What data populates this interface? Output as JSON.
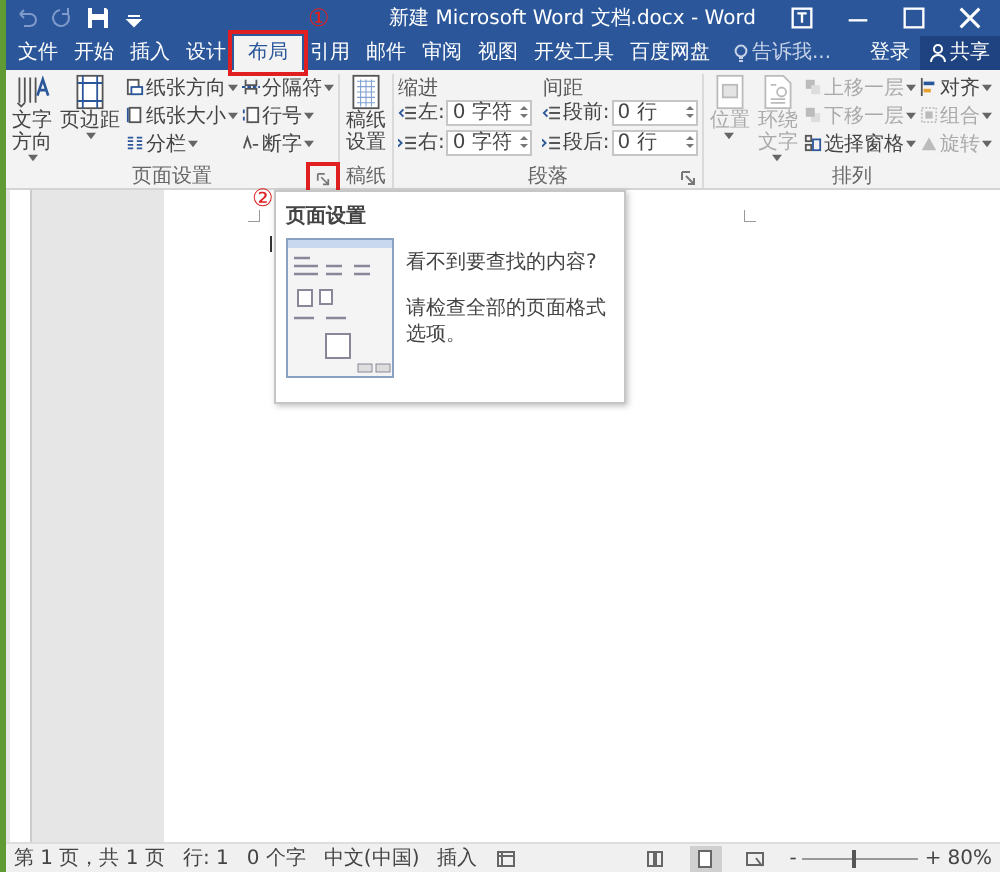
{
  "window": {
    "title": "新建 Microsoft Word 文档.docx - Word"
  },
  "quick_access": [
    {
      "kind": "undo",
      "disabled": true
    },
    {
      "kind": "redo",
      "disabled": true
    },
    {
      "kind": "save",
      "disabled": false
    },
    {
      "kind": "customize",
      "disabled": false
    }
  ],
  "window_controls": [
    {
      "kind": "ribbon-options"
    },
    {
      "kind": "minimize"
    },
    {
      "kind": "maximize"
    },
    {
      "kind": "close"
    }
  ],
  "tabs": [
    {
      "label": "文件",
      "selected": false
    },
    {
      "label": "开始",
      "selected": false
    },
    {
      "label": "插入",
      "selected": false
    },
    {
      "label": "设计",
      "selected": false
    },
    {
      "label": "布局",
      "selected": true,
      "callout": "①"
    },
    {
      "label": "引用",
      "selected": false
    },
    {
      "label": "邮件",
      "selected": false
    },
    {
      "label": "审阅",
      "selected": false
    },
    {
      "label": "视图",
      "selected": false
    },
    {
      "label": "开发工具",
      "selected": false
    },
    {
      "label": "百度网盘",
      "selected": false
    }
  ],
  "tell_me": {
    "placeholder": "告诉我..."
  },
  "account": {
    "sign_in": "登录",
    "share": "共享"
  },
  "page_setup": {
    "label": "页面设置",
    "callout": "②",
    "big_buttons": [
      {
        "label": "文字方向"
      },
      {
        "label": "页边距"
      }
    ],
    "small_buttons": [
      {
        "label": "纸张方向"
      },
      {
        "label": "纸张大小"
      },
      {
        "label": "分栏"
      },
      {
        "label": "分隔符"
      },
      {
        "label": "行号"
      },
      {
        "label": "断字"
      }
    ]
  },
  "manuscript": {
    "label": "稿纸",
    "button": "稿纸设置"
  },
  "paragraph": {
    "label": "段落",
    "indent": {
      "heading": "缩进",
      "rows": [
        {
          "label": "左:",
          "value": "0 字符"
        },
        {
          "label": "右:",
          "value": "0 字符"
        }
      ]
    },
    "spacing": {
      "heading": "间距",
      "rows": [
        {
          "label": "段前:",
          "value": "0 行"
        },
        {
          "label": "段后:",
          "value": "0 行"
        }
      ]
    }
  },
  "arrange": {
    "label": "排列",
    "big_buttons": [
      {
        "label": "位置",
        "disabled": true
      },
      {
        "label": "环绕文字",
        "disabled": true
      }
    ],
    "small_buttons": [
      {
        "label": "上移一层",
        "disabled": true
      },
      {
        "label": "下移一层",
        "disabled": true
      },
      {
        "label": "选择窗格",
        "disabled": false
      },
      {
        "label": "对齐",
        "disabled": false
      },
      {
        "label": "组合",
        "disabled": true
      },
      {
        "label": "旋转",
        "disabled": true
      }
    ]
  },
  "tooltip": {
    "title": "页面设置",
    "lines": [
      "看不到要查找的内容?",
      "请检查全部的页面格式选项。"
    ]
  },
  "status_bar": {
    "items": [
      "第 1 页，共 1 页",
      "行: 1",
      "0 个字",
      "中文(中国)",
      "插入"
    ],
    "views": [
      {
        "kind": "read",
        "selected": false
      },
      {
        "kind": "print",
        "selected": true
      },
      {
        "kind": "web",
        "selected": false
      }
    ],
    "zoom": {
      "out": "-",
      "in": "+",
      "level": 0.45,
      "reading": "80%"
    }
  }
}
